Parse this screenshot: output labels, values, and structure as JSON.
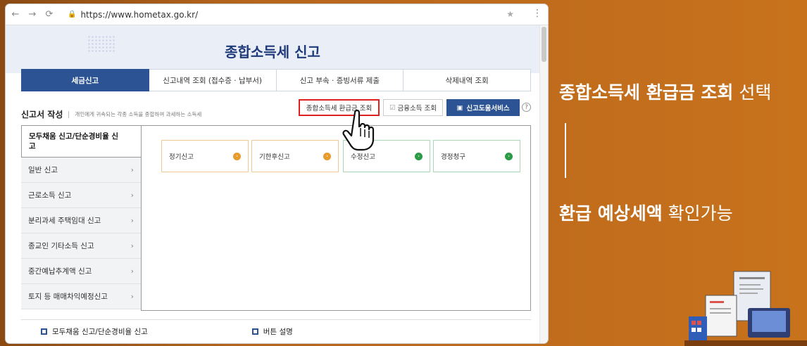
{
  "browser": {
    "url": "https://www.hometax.go.kr/",
    "nav": {
      "back": "←",
      "forward": "→",
      "reload": "⟳"
    }
  },
  "page": {
    "title": "종합소득세 신고",
    "tabs": [
      {
        "label": "세금신고",
        "active": true
      },
      {
        "label": "신고내역 조회 (접수증 · 납부서)",
        "active": false
      },
      {
        "label": "신고 부속 · 증빙서류 제출",
        "active": false
      },
      {
        "label": "삭제내역 조회",
        "active": false
      }
    ],
    "section": {
      "title": "신고서 작성",
      "description": "개인에게 귀속되는 각종 소득을 종합하여 과세하는 소득세"
    },
    "buttons": {
      "refund": "종합소득세 환급금 조회",
      "finance": "금융소득 조회",
      "help": "신고도움서비스",
      "question": "?"
    },
    "menu": [
      {
        "label": "모두채움 신고/단순경비율 신고",
        "active": true
      },
      {
        "label": "일반 신고",
        "active": false
      },
      {
        "label": "근로소득 신고",
        "active": false
      },
      {
        "label": "분리과세 주택임대 신고",
        "active": false
      },
      {
        "label": "종교인 기타소득 신고",
        "active": false
      },
      {
        "label": "중간예납추계액 신고",
        "active": false
      },
      {
        "label": "토지 등 매매차익예정신고",
        "active": false
      }
    ],
    "cards": [
      {
        "label": "정기신고",
        "color": "#e89a2b"
      },
      {
        "label": "기한후신고",
        "color": "#e89a2b"
      },
      {
        "label": "수정신고",
        "color": "#2a9a45"
      },
      {
        "label": "경정청구",
        "color": "#2a9a45"
      }
    ],
    "footer": {
      "link1": "모두채움 신고/단순경비율 신고",
      "link2": "버튼 설명"
    }
  },
  "overlay": {
    "headline_bold": "종합소득세 환급금 조회",
    "headline_light": " 선택",
    "sub_bold": "환급 예상세액",
    "sub_light": " 확인가능"
  },
  "colors": {
    "accent": "#2c5494",
    "highlight_box": "#e02020",
    "background": "#c8721c"
  }
}
